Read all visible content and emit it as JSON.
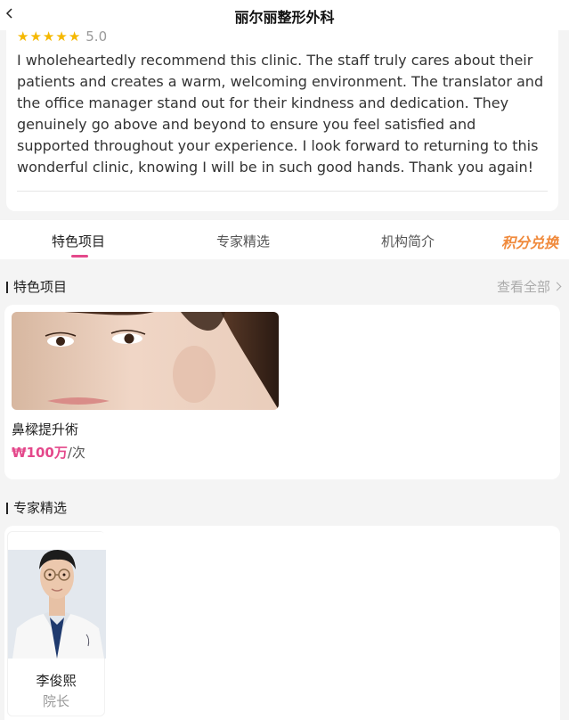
{
  "header": {
    "title": "丽尔丽整形外科"
  },
  "review": {
    "stars": [
      "★",
      "★",
      "★",
      "★",
      "★"
    ],
    "score": "5.0",
    "text": "I wholeheartedly recommend this clinic. The staff truly cares about their patients and creates a warm, welcoming environment. The translator and the office manager stand out for their kindness and dedication. They genuinely go above and beyond to ensure you feel satisfied and supported throughout your experience. I look forward to returning to this wonderful clinic, knowing I will be in such good hands. Thank you again!"
  },
  "tabs": {
    "items": [
      "特色项目",
      "专家精选",
      "机构简介"
    ],
    "points": "积分兑换",
    "active_index": 0
  },
  "featured": {
    "title": "特色项目",
    "see_all": "查看全部",
    "products": [
      {
        "name": "鼻樑提升術",
        "price": "₩100万",
        "unit": "/次"
      }
    ]
  },
  "experts": {
    "title": "专家精选",
    "items": [
      {
        "name": "李俊熙",
        "role": "院长"
      }
    ]
  },
  "colors": {
    "accent_pink": "#e4488b",
    "points_orange": "#f08a3c",
    "star_gold": "#f5b800"
  },
  "icons": [
    "back-arrow-icon",
    "chevron-right-icon",
    "star-icon"
  ]
}
